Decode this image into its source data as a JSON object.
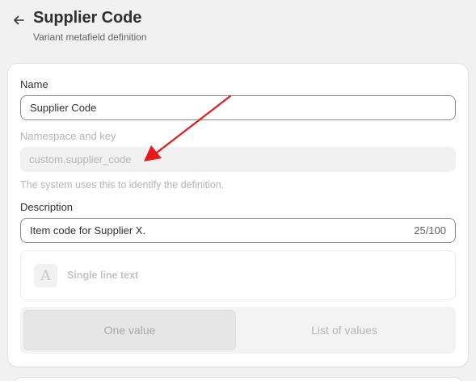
{
  "header": {
    "back_icon": "arrow-left-icon",
    "title": "Supplier Code",
    "subtitle": "Variant metafield definition"
  },
  "form": {
    "name_label": "Name",
    "name_value": "Supplier Code",
    "namespace_label": "Namespace and key",
    "namespace_value": "custom.supplier_code",
    "namespace_help": "The system uses this to identify the definition.",
    "description_label": "Description",
    "description_value": "Item code for Supplier X.",
    "description_counter": "25/100",
    "type_icon_letter": "A",
    "type_label": "Single line text",
    "value_options": [
      "One value",
      "List of values"
    ],
    "selected_option": "One value"
  },
  "annotation": {
    "arrow_color": "#e8191b"
  },
  "colors": {
    "page_bg": "#f1f1f1",
    "card_bg": "#ffffff",
    "text_primary": "#303030",
    "text_muted": "#b5b5b5"
  }
}
